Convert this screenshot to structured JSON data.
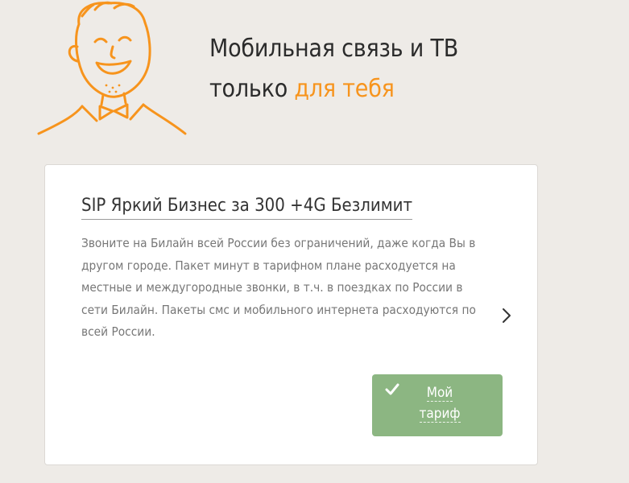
{
  "hero": {
    "line1": "Мобильная связь и ТВ",
    "line2_plain": "только ",
    "line2_accent": "для тебя"
  },
  "tariff": {
    "title": "SIP Яркий Бизнес за 300 +4G Безлимит",
    "description": "Звоните на Билайн всей России без ограничений, даже когда Вы в другом городе. Пакет минут в тарифном плане расходуется на местные и междугородные звонки, в т.ч. в поездках по России в сети Билайн. Пакеты смс и мобильного интернета расходуются по всей России.",
    "button_label": "Мой тариф"
  },
  "icons": {
    "mascot": "smiling-man-illustration",
    "chevron": "chevron-right-icon",
    "check": "checkmark-icon"
  },
  "colors": {
    "background": "#eeebe7",
    "accent": "#f7941d",
    "button": "#8cb682",
    "card": "#ffffff"
  }
}
